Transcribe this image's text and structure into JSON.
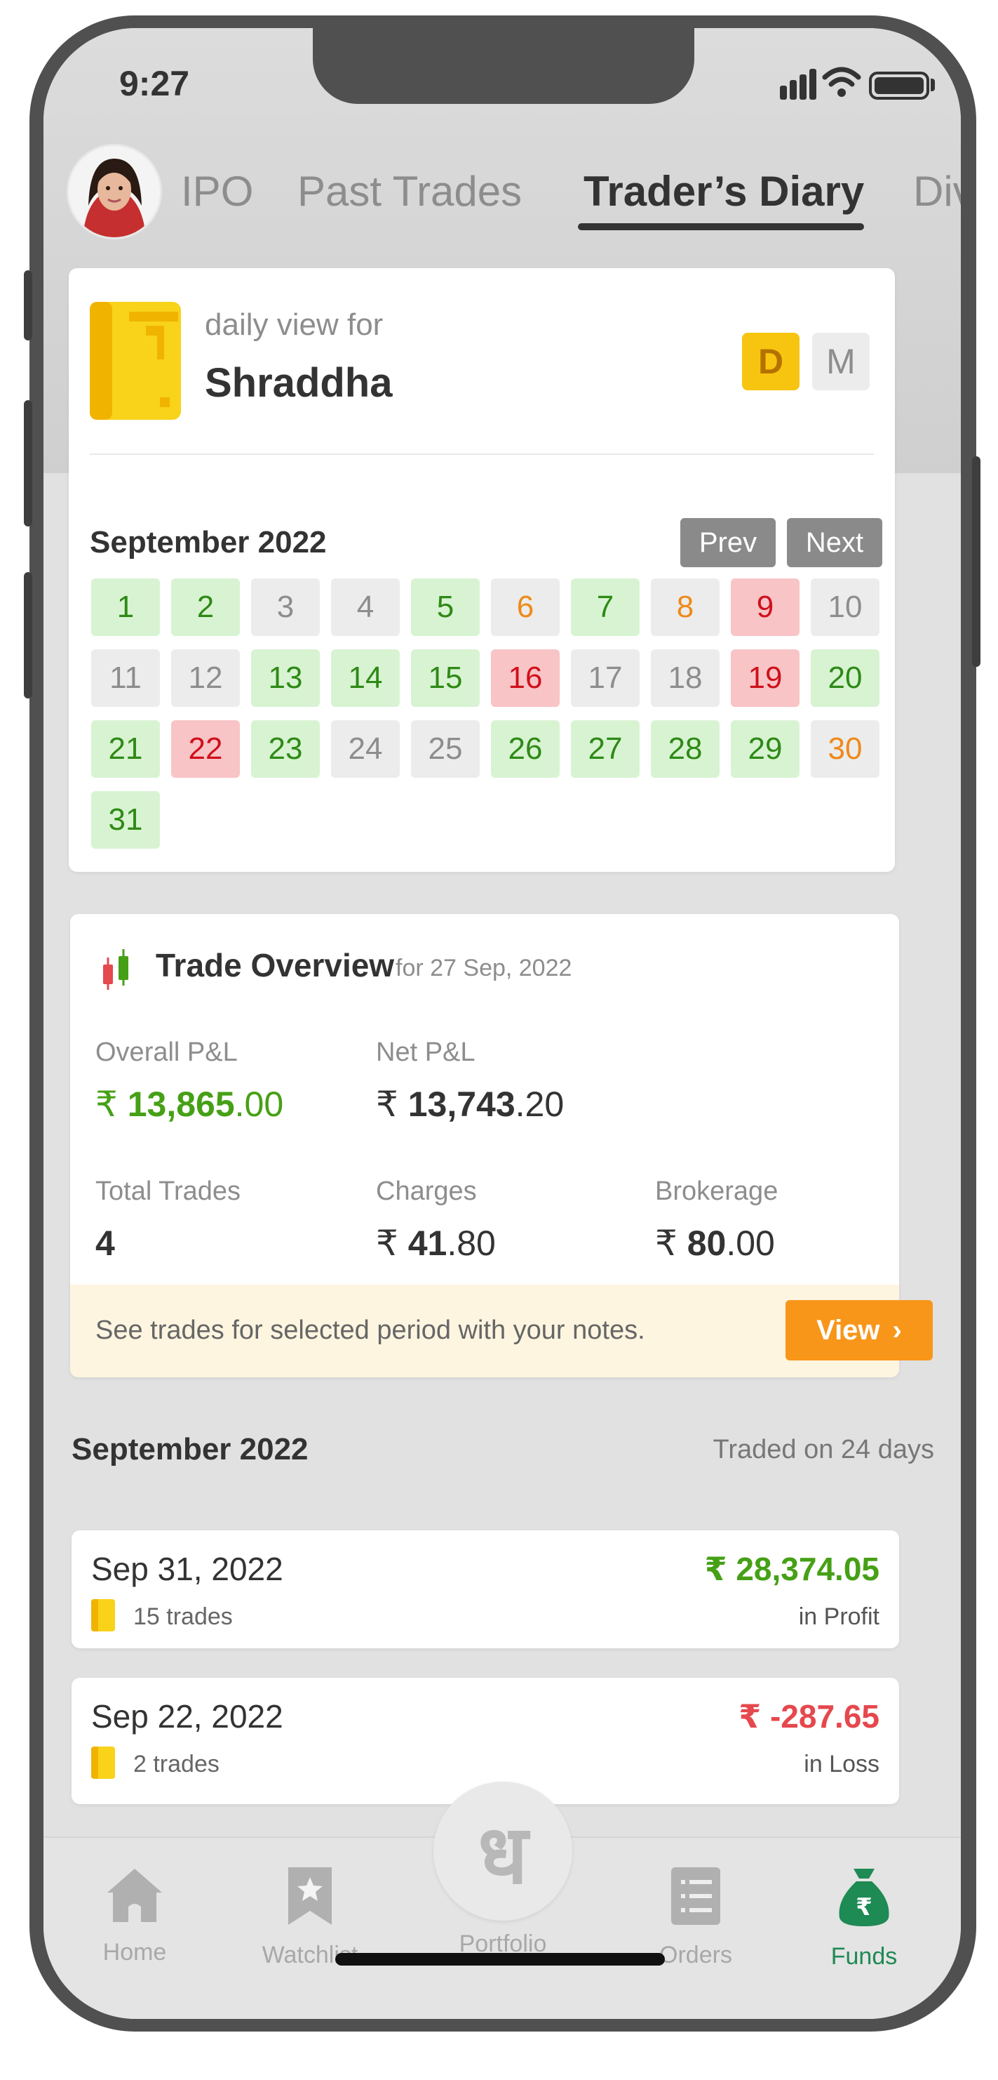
{
  "status_bar": {
    "time": "9:27"
  },
  "tabs": [
    {
      "label": "IPO",
      "active": false
    },
    {
      "label": "Past Trades",
      "active": false
    },
    {
      "label": "Trader’s Diary",
      "active": true
    },
    {
      "label": "Div",
      "active": false
    }
  ],
  "diary": {
    "subtitle": "daily view for",
    "name": "Shraddha",
    "mode_daily": "D",
    "mode_monthly": "M",
    "selected_mode": "D"
  },
  "calendar": {
    "month": "September 2022",
    "prev_label": "Prev",
    "next_label": "Next",
    "days": [
      {
        "d": "1",
        "s": "profit"
      },
      {
        "d": "2",
        "s": "profit"
      },
      {
        "d": "3",
        "s": "none"
      },
      {
        "d": "4",
        "s": "none"
      },
      {
        "d": "5",
        "s": "profit"
      },
      {
        "d": "6",
        "s": "neutral"
      },
      {
        "d": "7",
        "s": "profit"
      },
      {
        "d": "8",
        "s": "neutral"
      },
      {
        "d": "9",
        "s": "loss"
      },
      {
        "d": "10",
        "s": "none"
      },
      {
        "d": "11",
        "s": "none"
      },
      {
        "d": "12",
        "s": "none"
      },
      {
        "d": "13",
        "s": "profit"
      },
      {
        "d": "14",
        "s": "profit"
      },
      {
        "d": "15",
        "s": "profit"
      },
      {
        "d": "16",
        "s": "loss"
      },
      {
        "d": "17",
        "s": "none"
      },
      {
        "d": "18",
        "s": "none"
      },
      {
        "d": "19",
        "s": "loss"
      },
      {
        "d": "20",
        "s": "profit"
      },
      {
        "d": "21",
        "s": "profit"
      },
      {
        "d": "22",
        "s": "loss"
      },
      {
        "d": "23",
        "s": "profit"
      },
      {
        "d": "24",
        "s": "none"
      },
      {
        "d": "25",
        "s": "none"
      },
      {
        "d": "26",
        "s": "profit"
      },
      {
        "d": "27",
        "s": "profit"
      },
      {
        "d": "28",
        "s": "profit"
      },
      {
        "d": "29",
        "s": "profit"
      },
      {
        "d": "30",
        "s": "neutral"
      },
      {
        "d": "31",
        "s": "profit"
      }
    ]
  },
  "overview": {
    "title": "Trade Overview",
    "date_prefix": "for 27 Sep, 2022",
    "currency": "₹",
    "overall_label": "Overall P&L",
    "overall_int": "13,865",
    "overall_dec": ".00",
    "net_label": "Net P&L",
    "net_int": "13,743",
    "net_dec": ".20",
    "total_trades_label": "Total Trades",
    "total_trades": "4",
    "charges_label": "Charges",
    "charges_int": "41",
    "charges_dec": ".80",
    "brokerage_label": "Brokerage",
    "brokerage_int": "80",
    "brokerage_dec": ".00",
    "notes_text": "See trades for selected period with your notes.",
    "view_label": "View",
    "view_icon": "chevron-right"
  },
  "monthly_summary": {
    "month": "September 2022",
    "traded_days": "Traded on 24 days"
  },
  "daily_rows": [
    {
      "date": "Sep 31, 2022",
      "amount": "₹ 28,374.05",
      "trades": "15 trades",
      "status": "in Profit",
      "type": "profit"
    },
    {
      "date": "Sep 22, 2022",
      "amount": "₹ -287.65",
      "trades": "2 trades",
      "status": "in Loss",
      "type": "loss"
    }
  ],
  "bottom_nav": [
    {
      "label": "Home",
      "icon": "home-icon"
    },
    {
      "label": "Watchlist",
      "icon": "bookmark-star-icon"
    },
    {
      "label": "Portfolio",
      "icon": "dhan-logo"
    },
    {
      "label": "Orders",
      "icon": "list-icon"
    },
    {
      "label": "Funds",
      "icon": "money-bag-icon",
      "active": true
    }
  ],
  "portfolio_logo_glyph": "ध",
  "colors": {
    "profit": "#46a016",
    "loss": "#e5484d",
    "accent_orange": "#f8961a",
    "active_nav": "#1e8a54",
    "diary_yellow": "#f7c50f"
  }
}
